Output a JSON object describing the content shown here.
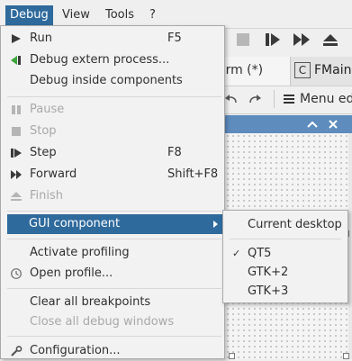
{
  "menubar": {
    "items": [
      "Debug",
      "View",
      "Tools",
      "?"
    ]
  },
  "tabs": {
    "tab1_label": "orm (*)",
    "tab2_icon": "C",
    "tab2_label": "FMain"
  },
  "toolbar2": {
    "menu_label": "Menu ed"
  },
  "debug_menu": {
    "items": [
      {
        "label": "Run",
        "shortcut": "F5",
        "icon": "play-icon",
        "enabled": true
      },
      {
        "label": "Debug extern process...",
        "shortcut": "",
        "icon": "green-arrow-icon",
        "enabled": true
      },
      {
        "label": "Debug inside components",
        "shortcut": "",
        "icon": "",
        "enabled": true
      },
      {
        "label": "Pause",
        "shortcut": "",
        "icon": "pause-icon",
        "enabled": false
      },
      {
        "label": "Stop",
        "shortcut": "",
        "icon": "stop-icon",
        "enabled": false
      },
      {
        "label": "Step",
        "shortcut": "F8",
        "icon": "step-icon",
        "enabled": true
      },
      {
        "label": "Forward",
        "shortcut": "Shift+F8",
        "icon": "forward-icon",
        "enabled": true
      },
      {
        "label": "Finish",
        "shortcut": "",
        "icon": "eject-icon",
        "enabled": false
      },
      {
        "label": "GUI component",
        "shortcut": "",
        "icon": "",
        "enabled": true
      },
      {
        "label": "Activate profiling",
        "shortcut": "",
        "icon": "",
        "enabled": true
      },
      {
        "label": "Open profile...",
        "shortcut": "",
        "icon": "clock-icon",
        "enabled": true
      },
      {
        "label": "Clear all breakpoints",
        "shortcut": "",
        "icon": "",
        "enabled": true
      },
      {
        "label": "Close all debug windows",
        "shortcut": "",
        "icon": "",
        "enabled": false
      },
      {
        "label": "Configuration...",
        "shortcut": "",
        "icon": "wrench-icon",
        "enabled": true
      }
    ]
  },
  "gui_submenu": {
    "items": [
      {
        "label": "Current desktop",
        "checked": false
      },
      {
        "label": "QT5",
        "checked": true
      },
      {
        "label": "GTK+2",
        "checked": false
      },
      {
        "label": "GTK+3",
        "checked": false
      }
    ],
    "check_glyph": "✓"
  },
  "colors": {
    "highlight": "#2f6a9c",
    "menu_bg": "#f2f2f2",
    "disabled_text": "#a8a8a8",
    "form_title": "#5d8cbd"
  }
}
